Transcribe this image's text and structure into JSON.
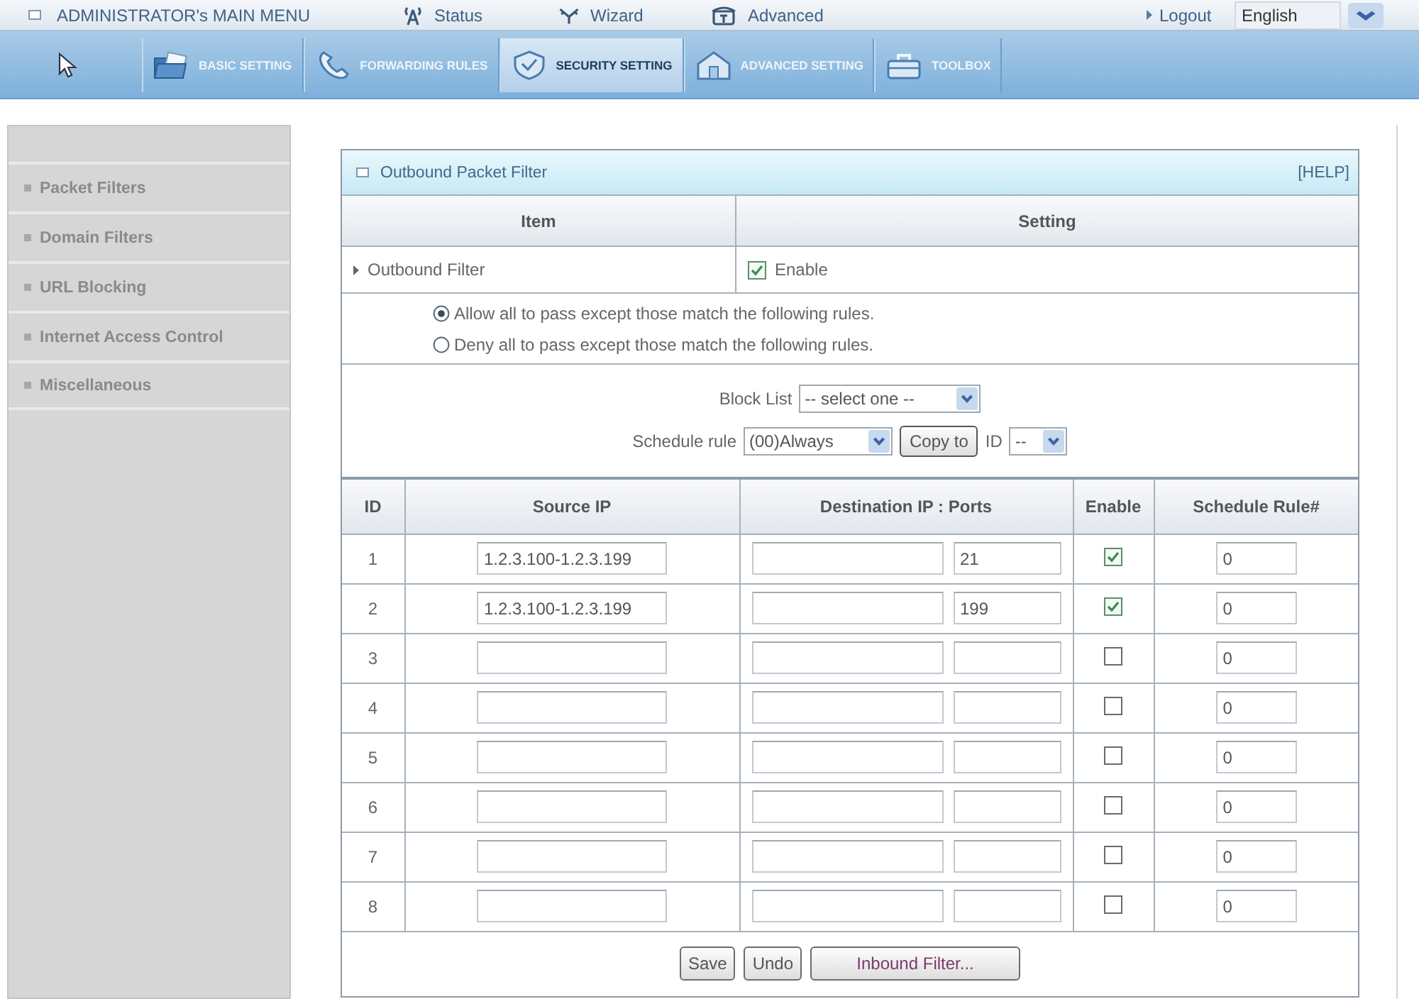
{
  "top_menu": {
    "title": "ADMINISTRATOR's MAIN MENU",
    "links": [
      {
        "kind": "status",
        "label": "Status"
      },
      {
        "kind": "wizard",
        "label": "Wizard"
      },
      {
        "kind": "advanced",
        "label": "Advanced"
      }
    ],
    "logout": "Logout",
    "language": "English"
  },
  "nav_tabs": [
    {
      "kind": "basic",
      "label": "BASIC SETTING",
      "selected": false
    },
    {
      "kind": "forwarding",
      "label": "FORWARDING RULES",
      "selected": false
    },
    {
      "kind": "security",
      "label": "SECURITY SETTING",
      "selected": true
    },
    {
      "kind": "advanced",
      "label": "ADVANCED SETTING",
      "selected": false
    },
    {
      "kind": "toolbox",
      "label": "TOOLBOX",
      "selected": false
    }
  ],
  "sidebar": {
    "items": [
      "Packet Filters",
      "Domain Filters",
      "URL Blocking",
      "Internet Access Control",
      "Miscellaneous"
    ]
  },
  "panel": {
    "title": "Outbound Packet Filter",
    "help": "[HELP]",
    "columns": [
      "Item",
      "Setting"
    ],
    "outbound_filter": {
      "label": "Outbound Filter",
      "option": "Enable",
      "checked": true
    },
    "policies": [
      {
        "label": "Allow all to pass except those match the following rules.",
        "selected": true
      },
      {
        "label": "Deny all to pass except those match the following rules.",
        "selected": false
      }
    ],
    "block_list": {
      "label": "Block List",
      "value": "-- select one --"
    },
    "schedule": {
      "label": "Schedule rule",
      "value": "(00)Always",
      "copy_button": "Copy to",
      "id_label": "ID",
      "id_value": "--"
    },
    "rules": {
      "columns": [
        "ID",
        "Source IP",
        "Destination IP : Ports",
        "Enable",
        "Schedule Rule#"
      ],
      "rows": [
        {
          "id": "1",
          "source_ip": "1.2.3.100-1.2.3.199",
          "port": "21",
          "enabled": true,
          "schedule_rule": "0"
        },
        {
          "id": "2",
          "source_ip": "1.2.3.100-1.2.3.199",
          "port": "199",
          "enabled": true,
          "schedule_rule": "0"
        },
        {
          "id": "3",
          "enabled": false,
          "schedule_rule": "0"
        },
        {
          "id": "4",
          "enabled": false,
          "schedule_rule": "0"
        },
        {
          "id": "5",
          "enabled": false,
          "schedule_rule": "0"
        },
        {
          "id": "6",
          "enabled": false,
          "schedule_rule": "0"
        },
        {
          "id": "7",
          "enabled": false,
          "schedule_rule": "0"
        },
        {
          "id": "8",
          "enabled": false,
          "schedule_rule": "0"
        }
      ]
    },
    "buttons": [
      "Save",
      "Undo",
      "Inbound Filter..."
    ]
  }
}
